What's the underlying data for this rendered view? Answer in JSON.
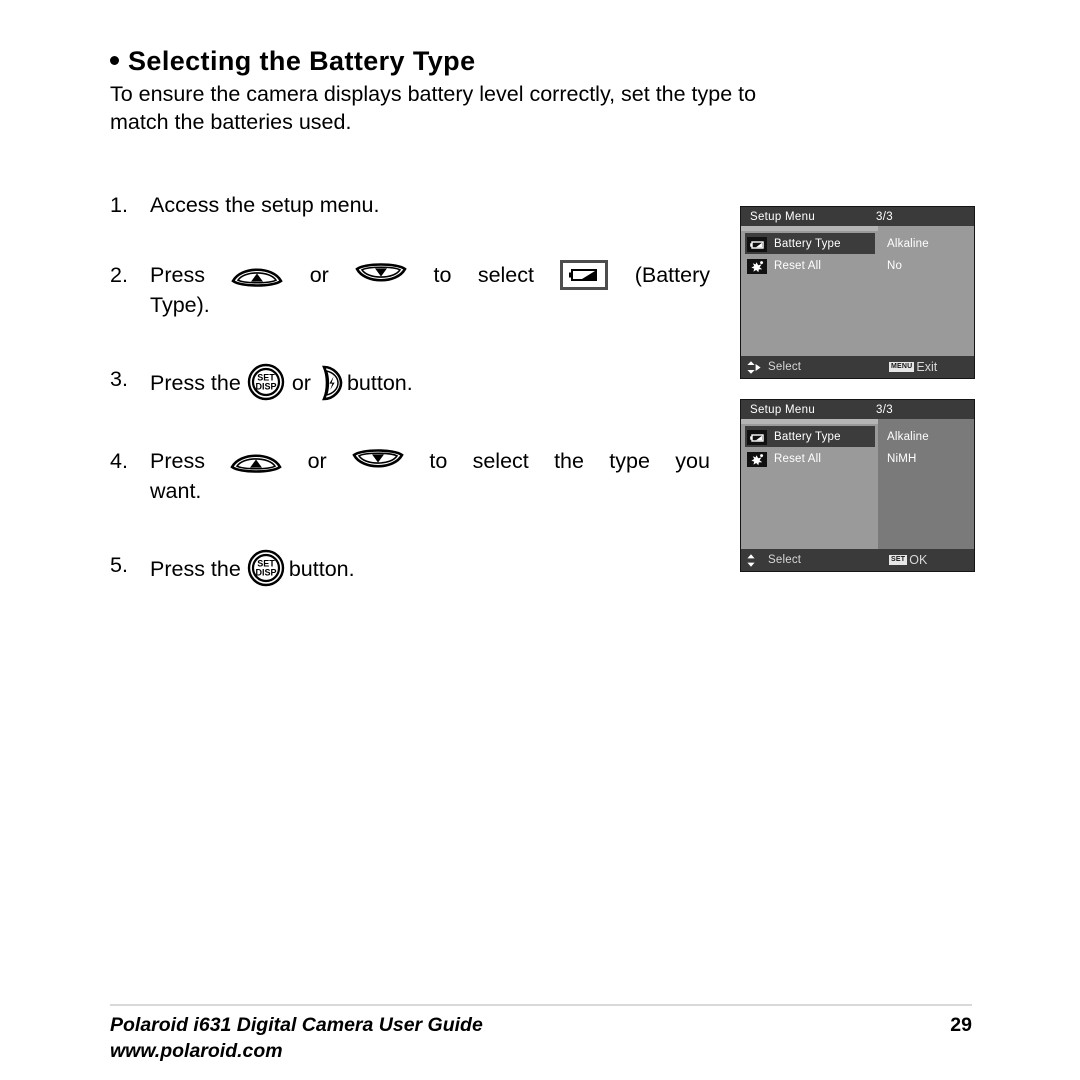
{
  "heading": {
    "bullet": "bullet-dot",
    "text": "Selecting the Battery Type"
  },
  "intro": {
    "line1": "To ensure the camera displays battery level correctly, set the type to",
    "line2": "match the batteries used."
  },
  "steps": [
    {
      "num": "1.",
      "text": "Access the setup menu."
    },
    {
      "num": "2.",
      "text_a": "Press",
      "icon_a": "up-arrow-button-icon",
      "text_b": "or",
      "icon_b": "down-arrow-button-icon",
      "text_c": "to",
      "text_d": "select",
      "icon_c": "battery-type-icon",
      "text_e": "(Battery",
      "text_f": "Type)."
    },
    {
      "num": "3.",
      "text_a": "Press the",
      "icon_a": "set-disp-button-icon",
      "text_b": "or",
      "icon_b": "flash-right-button-icon",
      "text_c": "button."
    },
    {
      "num": "4.",
      "text_a": "Press",
      "icon_a": "up-arrow-button-icon",
      "text_b": "or",
      "icon_b": "down-arrow-button-icon",
      "text_c": "to",
      "text_d": "select",
      "text_e": "the",
      "text_f": "type",
      "text_g": "you",
      "text_h": "want."
    },
    {
      "num": "5.",
      "text_a": "Press the",
      "icon_a": "set-disp-button-icon",
      "text_b": "button."
    }
  ],
  "button_labels": {
    "set": "SET",
    "disp": "DISP"
  },
  "screens": [
    {
      "header_title": "Setup Menu",
      "header_page": "3/3",
      "items": [
        {
          "icon": "battery-type-icon",
          "label": "Battery Type",
          "selected": true
        },
        {
          "icon": "reset-all-icon",
          "label": "Reset All",
          "selected": false
        }
      ],
      "values": [
        "Alkaline",
        "No"
      ],
      "footer_left": "Select",
      "footer_left_icon": "up-down-right-arrows-icon",
      "footer_badge": "MENU",
      "footer_right": "Exit"
    },
    {
      "header_title": "Setup Menu",
      "header_page": "3/3",
      "items": [
        {
          "icon": "battery-type-icon",
          "label": "Battery Type",
          "selected": true
        },
        {
          "icon": "reset-all-icon",
          "label": "Reset All",
          "selected": false
        }
      ],
      "values": [
        "Alkaline",
        "NiMH"
      ],
      "footer_left": "Select",
      "footer_left_icon": "up-down-arrows-icon",
      "footer_badge": "SET",
      "footer_right": "OK"
    }
  ],
  "footer": {
    "title": "Polaroid i631 Digital Camera User Guide",
    "url": "www.polaroid.com",
    "page": "29"
  },
  "colors": {
    "lcd_background": "#9a9a9a",
    "lcd_header": "#3a3a3a",
    "lcd_selected_row": "#3c3c3c",
    "lcd_right_panel_dark": "#7a7a7a",
    "text": "#000000",
    "lcd_text": "#ffffff"
  }
}
